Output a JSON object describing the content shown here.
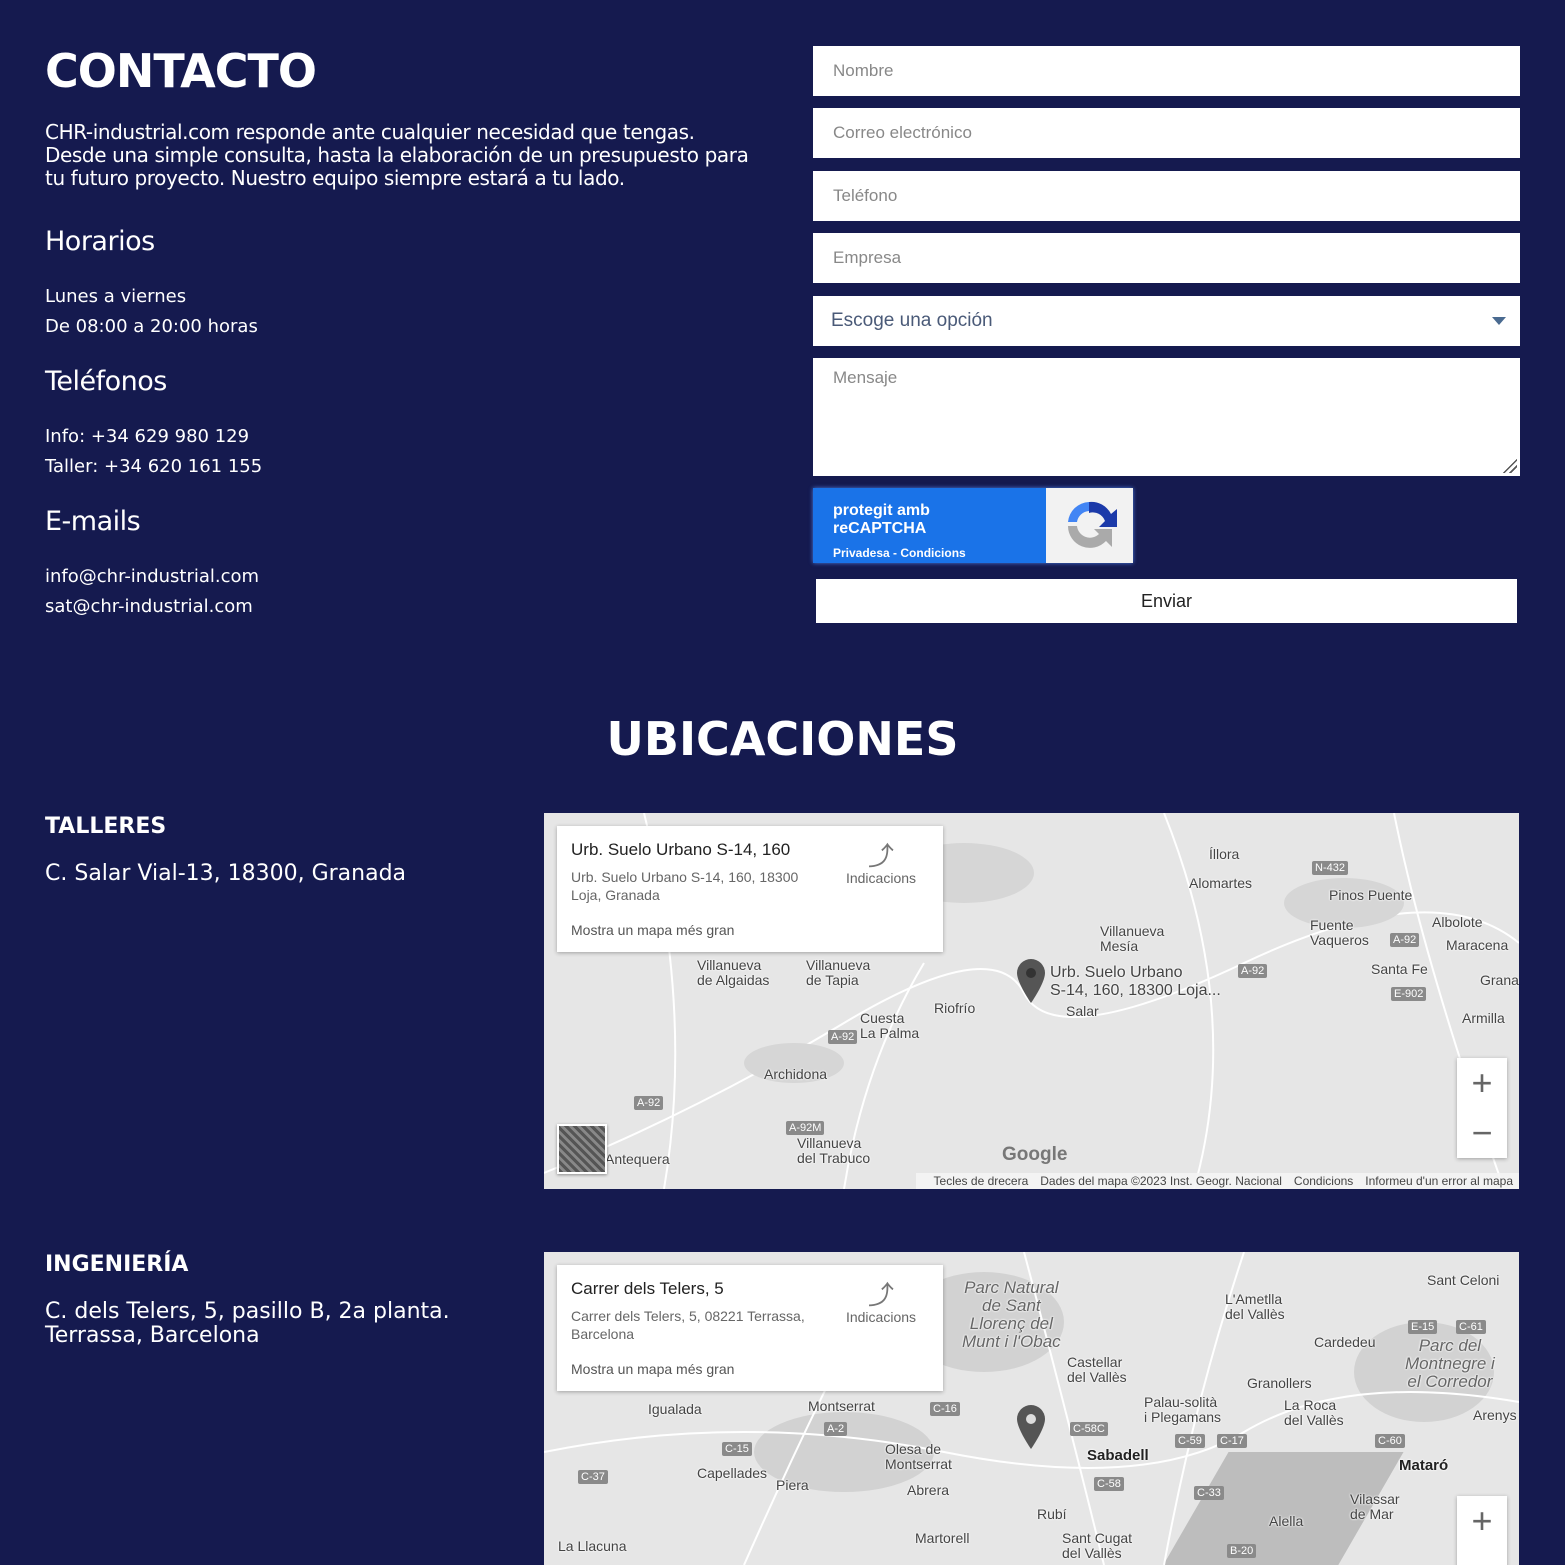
{
  "contact": {
    "title": "CONTACTO",
    "intro": [
      "CHR-industrial.com responde ante cualquier necesidad que tengas.",
      "Desde una simple consulta, hasta la elaboración de un presupuesto para",
      "tu futuro proyecto. Nuestro equipo siempre estará a tu lado."
    ],
    "hours": {
      "title": "Horarios",
      "lines": [
        "Lunes a viernes",
        "De 08:00 a 20:00 horas"
      ]
    },
    "phones": {
      "title": "Teléfonos",
      "lines": [
        "Info: +34 629 980 129",
        "Taller: +34 620 161 155"
      ]
    },
    "emails": {
      "title": "E-mails",
      "lines": [
        "info@chr-industrial.com",
        "sat@chr-industrial.com"
      ]
    }
  },
  "form": {
    "name_placeholder": "Nombre",
    "email_placeholder": "Correo electrónico",
    "phone_placeholder": "Teléfono",
    "company_placeholder": "Empresa",
    "select_value": "Escoge una opción",
    "message_placeholder": "Mensaje",
    "recaptcha": {
      "title": "protegit amb reCAPTCHA",
      "links": "Privadesa - Condicions"
    },
    "submit": "Enviar"
  },
  "locations": {
    "title": "UBICACIONES",
    "items": [
      {
        "title": "TALLERES",
        "address": "C. Salar Vial-13, 18300, Granada"
      },
      {
        "title": "INGENIERÍA",
        "address": "C. dels Telers, 5, pasillo B, 2a planta. Terrassa, Barcelona"
      }
    ]
  },
  "maps": [
    {
      "card_title": "Urb. Suelo Urbano S-14, 160",
      "card_address": "Urb. Suelo Urbano S-14, 160, 18300 Loja, Granada",
      "directions": "Indicacions",
      "larger_map": "Mostra un mapa més gran",
      "pin_label": "Urb. Suelo Urbano\nS-14, 160, 18300 Loja...",
      "labels": [
        "Íllora",
        "Alomartes",
        "Pinos Puente",
        "Villanueva\nMesía",
        "Fuente\nVaqueros",
        "Albolote",
        "Maracena",
        "Santa Fe",
        "Armilla",
        "Villanueva\nde Algaidas",
        "Villanueva\nde Tapia",
        "Riofrío",
        "Cuesta\nLa Palma",
        "Salar",
        "Archidona",
        "Villanueva\ndel Trabuco",
        "Antequera",
        "Grana"
      ],
      "roads": [
        "N-432",
        "A-92",
        "A-92",
        "E-902",
        "A-92",
        "A-92",
        "A-92M"
      ],
      "footer": [
        "Tecles de drecera",
        "Dades del mapa ©2023 Inst. Geogr. Nacional",
        "Condicions",
        "Informeu d'un error al mapa"
      ],
      "logo": "Google"
    },
    {
      "card_title": "Carrer dels Telers, 5",
      "card_address": "Carrer dels Telers, 5, 08221 Terrassa, Barcelona",
      "directions": "Indicacions",
      "larger_map": "Mostra un mapa més gran",
      "labels": [
        "L'Ametlla\ndel Vallès",
        "Sant Celoni",
        "Cardedeu",
        "Castellar\ndel Vallès",
        "Granollers",
        "Palau-solità\ni Plegamans",
        "La Roca\ndel Vallès",
        "Arenys",
        "Igualada",
        "Montserrat",
        "Olesa de\nMontserrat",
        "Capellades",
        "Piera",
        "Abrera",
        "Rubí",
        "Vilassar\nde Mar",
        "Alella",
        "Martorell",
        "Sant Cugat\ndel Vallès",
        "La Llacuna"
      ],
      "bold_labels": [
        "Sabadell",
        "Mataró"
      ],
      "parks": [
        "Parc Natural\nde Sant\nLlorenç del\nMunt i l'Obac",
        "Parc del\nMontnegre i\nel Corredor"
      ],
      "roads": [
        "C-16",
        "A-2",
        "C-58C",
        "C-15",
        "C-59",
        "C-17",
        "C-60",
        "E-15",
        "C-61",
        "C-37",
        "C-58",
        "C-33",
        "B-20"
      ]
    }
  ],
  "colors": {
    "background": "#151a4f",
    "recaptcha": "#1a73e8"
  }
}
